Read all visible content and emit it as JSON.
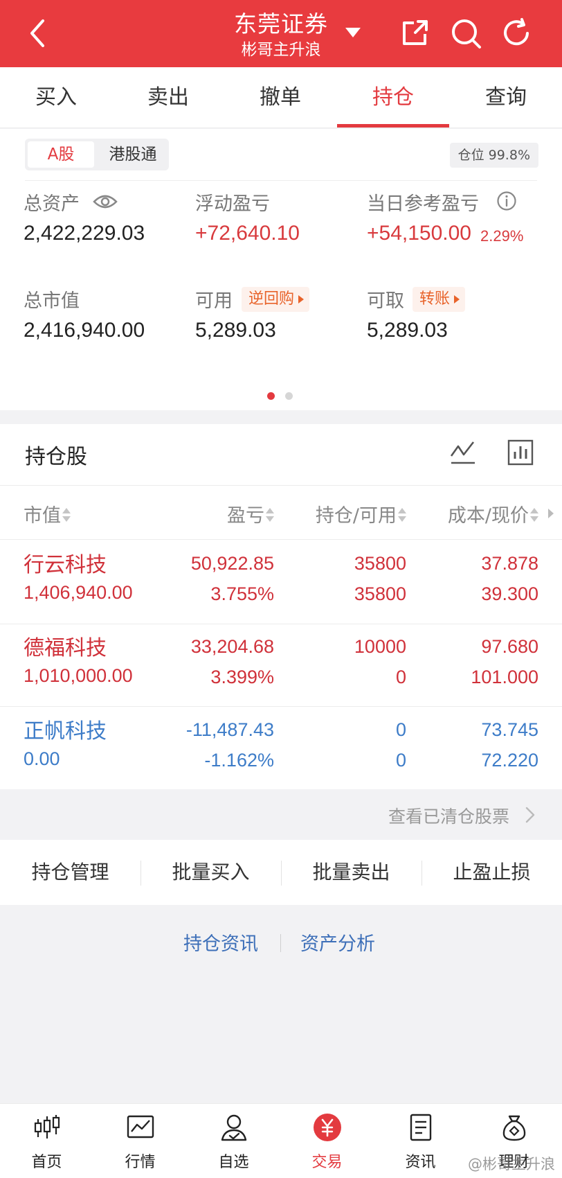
{
  "header": {
    "title": "东莞证券",
    "subtitle": "彬哥主升浪"
  },
  "tabs": [
    {
      "label": "买入",
      "active": false
    },
    {
      "label": "卖出",
      "active": false
    },
    {
      "label": "撤单",
      "active": false
    },
    {
      "label": "持仓",
      "active": true
    },
    {
      "label": "查询",
      "active": false
    }
  ],
  "market_toggle": {
    "a_share": "A股",
    "hk_connect": "港股通",
    "selected": "A股"
  },
  "position_ratio": "仓位 99.8%",
  "summary": {
    "total_assets": {
      "label": "总资产",
      "value": "2,422,229.03"
    },
    "floating_pnl": {
      "label": "浮动盈亏",
      "value": "+72,640.10"
    },
    "daily_pnl": {
      "label": "当日参考盈亏",
      "value": "+54,150.00",
      "pct": "2.29%"
    },
    "market_value": {
      "label": "总市值",
      "value": "2,416,940.00"
    },
    "available": {
      "label": "可用",
      "value": "5,289.03",
      "tag": "逆回购"
    },
    "withdrawable": {
      "label": "可取",
      "value": "5,289.03",
      "tag": "转账"
    },
    "page_indicator": {
      "current": 1,
      "total": 2
    }
  },
  "holdings": {
    "title": "持仓股",
    "columns": [
      "市值",
      "盈亏",
      "持仓/可用",
      "成本/现价"
    ],
    "rows": [
      {
        "name": "行云科技",
        "market_value": "1,406,940.00",
        "pnl": "50,922.85",
        "pnl_pct": "3.755%",
        "position": "35800",
        "available": "35800",
        "cost": "37.878",
        "price": "39.300",
        "tone": "red"
      },
      {
        "name": "德福科技",
        "market_value": "1,010,000.00",
        "pnl": "33,204.68",
        "pnl_pct": "3.399%",
        "position": "10000",
        "available": "0",
        "cost": "97.680",
        "price": "101.000",
        "tone": "red"
      },
      {
        "name": "正帆科技",
        "market_value": "0.00",
        "pnl": "-11,487.43",
        "pnl_pct": "-1.162%",
        "position": "0",
        "available": "0",
        "cost": "73.745",
        "price": "72.220",
        "tone": "blue"
      }
    ]
  },
  "cleared_link": "查看已清仓股票",
  "actions": [
    "持仓管理",
    "批量买入",
    "批量卖出",
    "止盈止损"
  ],
  "links": [
    "持仓资讯",
    "资产分析"
  ],
  "bottom_nav": [
    {
      "label": "首页",
      "icon": "candlestick-icon",
      "active": false
    },
    {
      "label": "行情",
      "icon": "line-chart-icon",
      "active": false
    },
    {
      "label": "自选",
      "icon": "user-check-icon",
      "active": false
    },
    {
      "label": "交易",
      "icon": "yuan-icon",
      "active": true
    },
    {
      "label": "资讯",
      "icon": "document-icon",
      "active": false
    },
    {
      "label": "理财",
      "icon": "money-bag-icon",
      "active": false
    }
  ],
  "watermark": "@彬哥主升浪",
  "colors": {
    "brand_red": "#e83b3f",
    "loss_blue": "#3d7cc8",
    "tag_orange": "#e8632a"
  }
}
